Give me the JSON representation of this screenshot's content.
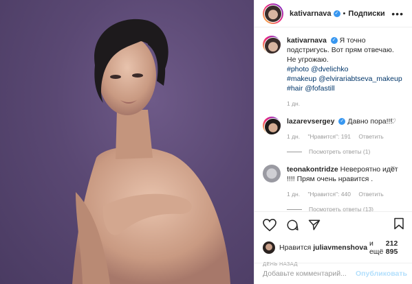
{
  "post": {
    "username": "kativarnava",
    "separator": "•",
    "follow_label": "Подписки",
    "more_icon": "more-options-icon"
  },
  "caption": {
    "username": "kativarnava",
    "text": "Я точно подстригусь. Вот прям отвечаю. Не угрожаю.",
    "tags": [
      "#photo @dvelichko",
      "#makeup @elvirariabtseva_makeup",
      "#hair @fofastill"
    ],
    "time": "1 дн."
  },
  "comments": [
    {
      "username": "lazarevsergey",
      "verified": true,
      "text": "Давно пора!!!",
      "time": "1 дн.",
      "likes": "\"Нравится\": 191",
      "reply": "Ответить",
      "view_replies": "Посмотреть ответы (1)"
    },
    {
      "username": "teonakontridze",
      "verified": false,
      "text": "Невероятно идёт !!!! Прям очень нравится .",
      "time": "1 дн.",
      "likes": "\"Нравится\": 440",
      "reply": "Ответить",
      "view_replies": "Посмотреть ответы (13)"
    }
  ],
  "actions": {
    "likes_prefix": "Нравится",
    "likes_user": "juliavmenshova",
    "likes_suffix": "и ещё",
    "likes_count": "212 895",
    "posted_ago": "ДЕНЬ НАЗАД"
  },
  "add_comment": {
    "placeholder": "Добавьте комментарий...",
    "publish_label": "Опубликовать"
  },
  "colors": {
    "accent_blue": "#3897f0",
    "hashtag": "#003569",
    "muted": "#999999",
    "background": "#ffffff",
    "photo_bg": "#5a4873"
  }
}
